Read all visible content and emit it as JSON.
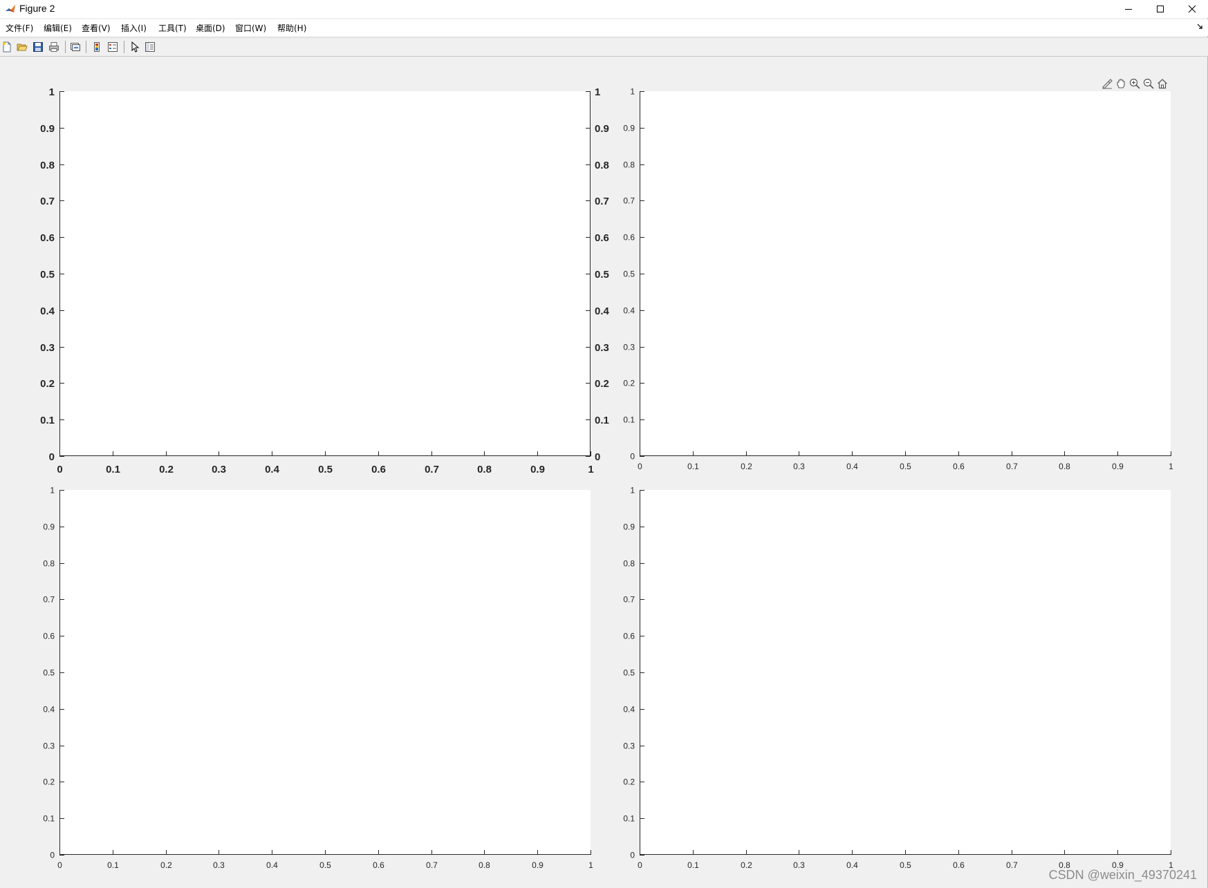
{
  "window": {
    "title": "Figure 2",
    "controls": [
      "minimize-icon",
      "maximize-icon",
      "close-icon"
    ]
  },
  "menu": {
    "items": [
      {
        "label": "文件(F)"
      },
      {
        "label": "编辑(E)"
      },
      {
        "label": "查看(V)"
      },
      {
        "label": "插入(I)"
      },
      {
        "label": "工具(T)"
      },
      {
        "label": "桌面(D)"
      },
      {
        "label": "窗口(W)"
      },
      {
        "label": "帮助(H)"
      }
    ]
  },
  "toolbar": {
    "icons": [
      "new-figure-icon",
      "open-file-icon",
      "save-icon",
      "print-icon",
      "link-plot-icon",
      "insert-colorbar-icon",
      "insert-legend-icon",
      "edit-plot-icon",
      "property-inspector-icon"
    ]
  },
  "axes_toolbar": {
    "icons": [
      "brush-icon",
      "pan-icon",
      "zoom-in-icon",
      "zoom-out-icon",
      "home-icon"
    ]
  },
  "watermark": "CSDN @weixin_49370241",
  "chart_data": [
    {
      "type": "line",
      "title": "",
      "xlabel": "",
      "ylabel": "",
      "xlim": [
        0,
        1
      ],
      "ylim": [
        0,
        1
      ],
      "xticks": [
        "0",
        "0.1",
        "0.2",
        "0.3",
        "0.4",
        "0.5",
        "0.6",
        "0.7",
        "0.8",
        "0.9",
        "1"
      ],
      "yticks": [
        "0",
        "0.1",
        "0.2",
        "0.3",
        "0.4",
        "0.5",
        "0.6",
        "0.7",
        "0.8",
        "0.9",
        "1"
      ],
      "right_yticks": [
        "0",
        "0.1",
        "0.2",
        "0.3",
        "0.4",
        "0.5",
        "0.6",
        "0.7",
        "0.8",
        "0.9",
        "1"
      ],
      "font_weight": "bold",
      "grid": false,
      "series": []
    },
    {
      "type": "line",
      "title": "",
      "xlabel": "",
      "ylabel": "",
      "xlim": [
        0,
        1
      ],
      "ylim": [
        0,
        1
      ],
      "xticks": [
        "0",
        "0.1",
        "0.2",
        "0.3",
        "0.4",
        "0.5",
        "0.6",
        "0.7",
        "0.8",
        "0.9",
        "1"
      ],
      "yticks": [
        "0",
        "0.1",
        "0.2",
        "0.3",
        "0.4",
        "0.5",
        "0.6",
        "0.7",
        "0.8",
        "0.9",
        "1"
      ],
      "right_yticks": [],
      "font_weight": "normal",
      "grid": false,
      "series": []
    },
    {
      "type": "line",
      "title": "",
      "xlabel": "",
      "ylabel": "",
      "xlim": [
        0,
        1
      ],
      "ylim": [
        0,
        1
      ],
      "xticks": [
        "0",
        "0.1",
        "0.2",
        "0.3",
        "0.4",
        "0.5",
        "0.6",
        "0.7",
        "0.8",
        "0.9",
        "1"
      ],
      "yticks": [
        "0",
        "0.1",
        "0.2",
        "0.3",
        "0.4",
        "0.5",
        "0.6",
        "0.7",
        "0.8",
        "0.9",
        "1"
      ],
      "right_yticks": [],
      "font_weight": "normal",
      "grid": false,
      "series": []
    },
    {
      "type": "line",
      "title": "",
      "xlabel": "",
      "ylabel": "",
      "xlim": [
        0,
        1
      ],
      "ylim": [
        0,
        1
      ],
      "xticks": [
        "0",
        "0.1",
        "0.2",
        "0.3",
        "0.4",
        "0.5",
        "0.6",
        "0.7",
        "0.8",
        "0.9",
        "1"
      ],
      "yticks": [
        "0",
        "0.1",
        "0.2",
        "0.3",
        "0.4",
        "0.5",
        "0.6",
        "0.7",
        "0.8",
        "0.9",
        "1"
      ],
      "right_yticks": [],
      "font_weight": "normal",
      "grid": false,
      "series": []
    }
  ]
}
